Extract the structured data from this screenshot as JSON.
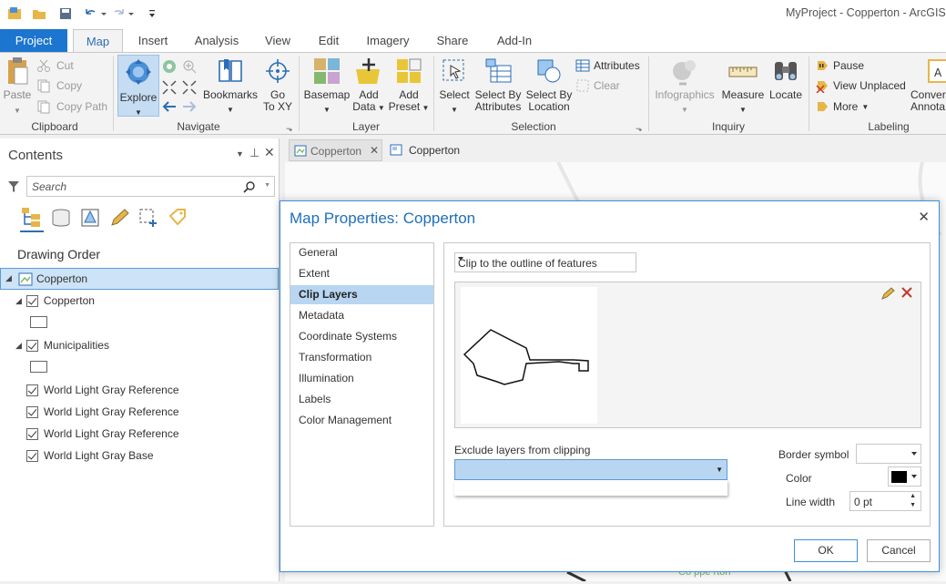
{
  "window_title": "MyProject - Copperton - ArcGIS P",
  "ribbon_tabs": [
    "Project",
    "Map",
    "Insert",
    "Analysis",
    "View",
    "Edit",
    "Imagery",
    "Share",
    "Add-In"
  ],
  "clipboard": {
    "paste": "Paste",
    "cut": "Cut",
    "copy": "Copy",
    "copy_path": "Copy Path",
    "label": "Clipboard"
  },
  "navigate": {
    "explore": "Explore",
    "bookmarks": "Bookmarks",
    "goto_1": "Go",
    "goto_2": "To XY",
    "label": "Navigate"
  },
  "layer": {
    "basemap": "Basemap",
    "add_data_1": "Add",
    "add_data_2": "Data",
    "add_preset_1": "Add",
    "add_preset_2": "Preset",
    "label": "Layer"
  },
  "selection": {
    "select": "Select",
    "sel_attr_1": "Select By",
    "sel_attr_2": "Attributes",
    "sel_loc_1": "Select By",
    "sel_loc_2": "Location",
    "attributes": "Attributes",
    "clear": "Clear",
    "label": "Selection"
  },
  "inquiry": {
    "infographics": "Infographics",
    "measure": "Measure",
    "locate": "Locate",
    "label": "Inquiry"
  },
  "labeling": {
    "pause": "Pause",
    "view_unplaced": "View Unplaced",
    "more": "More",
    "convert_1": "Conver",
    "convert_2": "Annota",
    "label": "Labeling"
  },
  "contents": {
    "title": "Contents",
    "search_placeholder": "Search",
    "drawing_order": "Drawing Order",
    "map_name": "Copperton",
    "layers": [
      {
        "name": "Copperton"
      },
      {
        "name": "Municipalities"
      },
      {
        "name": "World Light Gray Reference"
      },
      {
        "name": "World Light Gray Reference"
      },
      {
        "name": "World Light Gray Reference"
      },
      {
        "name": "World Light Gray Base"
      }
    ]
  },
  "view_tabs": [
    "Copperton",
    "Copperton"
  ],
  "dialog": {
    "title": "Map Properties: Copperton",
    "nav": [
      "General",
      "Extent",
      "Clip Layers",
      "Metadata",
      "Coordinate Systems",
      "Transformation",
      "Illumination",
      "Labels",
      "Color Management"
    ],
    "selected_nav": "Clip Layers",
    "clip_option": "Clip to the outline of features",
    "exclude_label": "Exclude layers from clipping",
    "border_symbol_label": "Border symbol",
    "color_label": "Color",
    "line_width_label": "Line width",
    "line_width_value": "0 pt",
    "ok": "OK",
    "cancel": "Cancel"
  },
  "map_text": "Co ppe rton",
  "colors": {
    "accent": "#1c75cf",
    "selection": "#b8d6f2",
    "title_blue": "#1e6fb8"
  }
}
